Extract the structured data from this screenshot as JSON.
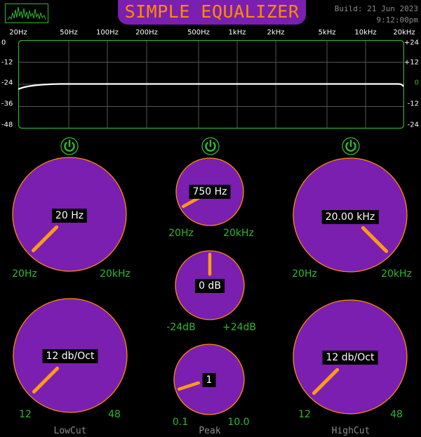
{
  "header": {
    "title": "SIMPLE EQUALIZER",
    "build": "Build: 21 Jun 2023",
    "time": "9:12:00pm"
  },
  "graph": {
    "freq_labels": [
      "20Hz",
      "50Hz",
      "100Hz",
      "200Hz",
      "500Hz",
      "1kHz",
      "2kHz",
      "5kHz",
      "10kHz",
      "20kHz"
    ],
    "db_left": [
      "0",
      "-12",
      "-24",
      "-36",
      "-48"
    ],
    "db_right": [
      "+24",
      "+12",
      "0",
      "-12",
      "-24"
    ],
    "colors": {
      "grid": "#555555",
      "border": "#2fb82f",
      "curve": "#ffffff"
    }
  },
  "bands": {
    "lowcut": {
      "label": "LowCut",
      "freq": {
        "value": "20 Hz",
        "min": "20Hz",
        "max": "20kHz",
        "fraction": 0.0
      },
      "slope": {
        "value": "12 db/Oct",
        "min": "12",
        "max": "48",
        "fraction": 0.0
      }
    },
    "peak": {
      "label": "Peak",
      "freq": {
        "value": "750 Hz",
        "min": "20Hz",
        "max": "20kHz",
        "fraction": 0.06
      },
      "gain": {
        "value": "0 dB",
        "min": "-24dB",
        "max": "+24dB",
        "fraction": 0.5
      },
      "quality": {
        "value": "1",
        "min": "0.1",
        "max": "10.0",
        "fraction": 0.1
      }
    },
    "highcut": {
      "label": "HighCut",
      "freq": {
        "value": "20.00 kHz",
        "min": "20Hz",
        "max": "20kHz",
        "fraction": 1.0
      },
      "slope": {
        "value": "12 db/Oct",
        "min": "12",
        "max": "48",
        "fraction": 0.0
      }
    }
  },
  "colors": {
    "knob_fill": "#7a1fb0",
    "knob_border": "#ff8c00",
    "pointer": "#ff9a1a",
    "label_green": "#2fb82f",
    "power_green": "#2fb82f"
  },
  "icons": [
    "spectrum-logo-icon",
    "power-icon"
  ]
}
